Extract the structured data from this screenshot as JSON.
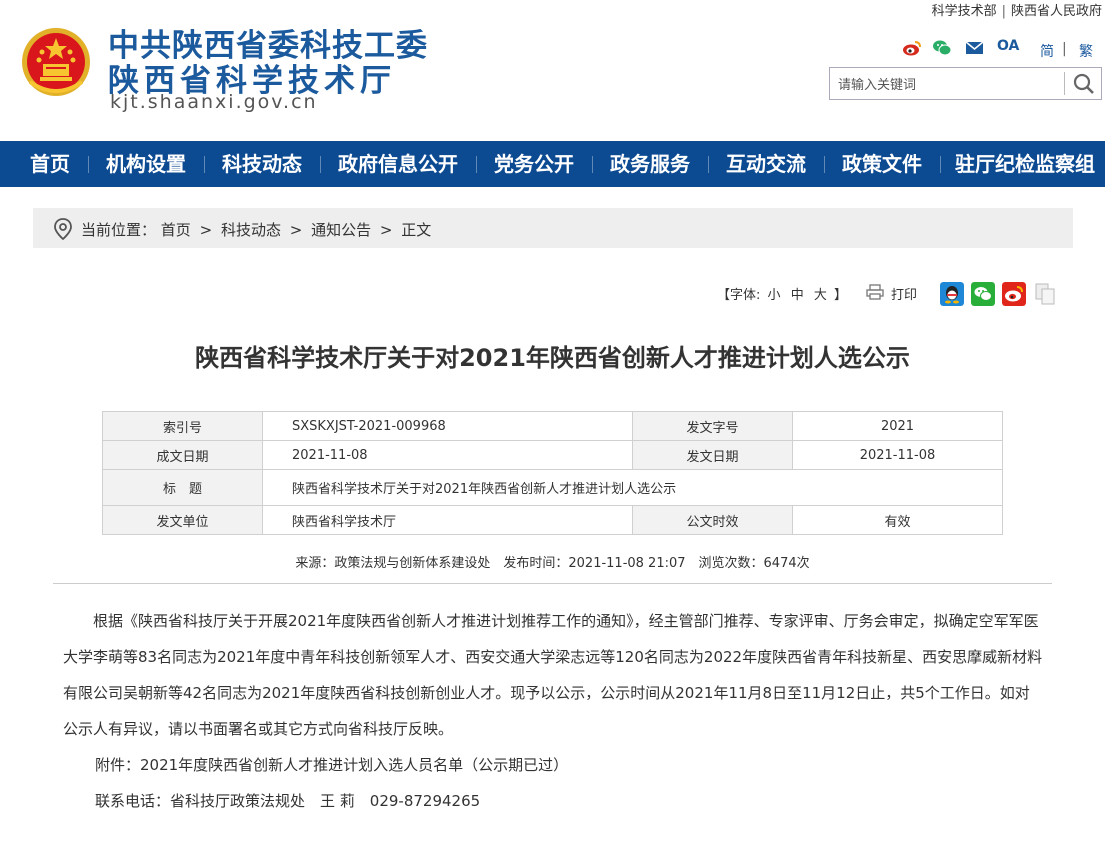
{
  "header": {
    "title_line1": "中共陕西省委科技工委",
    "title_line2": "陕西省科学技术厅",
    "domain": "kjt.shaanxi.gov.cn",
    "top_links": [
      "科学技术部",
      "陕西省人民政府"
    ],
    "top_link_separator": "|",
    "share_icons": [
      "weibo-icon",
      "wechat-icon",
      "mail-icon",
      "oa-icon"
    ],
    "oa_label": "OA",
    "lang_simplified": "简",
    "lang_separator": "|",
    "lang_traditional": "繁",
    "search_placeholder": "请输入关键词"
  },
  "nav": {
    "items": [
      "首页",
      "机构设置",
      "科技动态",
      "政府信息公开",
      "党务公开",
      "政务服务",
      "互动交流",
      "政策文件",
      "驻厅纪检监察组"
    ]
  },
  "breadcrumb": {
    "label": "当前位置：",
    "items": [
      "首页",
      "科技动态",
      "通知公告",
      "正文"
    ],
    "separator": ">"
  },
  "tools": {
    "font_prefix": "【字体:",
    "sizes": [
      "小",
      "中",
      "大"
    ],
    "font_suffix": "】",
    "print_label": "打印",
    "share": [
      "qq-icon",
      "wechat-icon",
      "weibo-icon",
      "copy-icon"
    ]
  },
  "article": {
    "title": "陕西省科学技术厅关于对2021年陕西省创新人才推进计划人选公示",
    "meta": {
      "index_no_label": "索引号",
      "index_no": "SXSKXJST-2021-009968",
      "doc_no_label": "发文字号",
      "doc_no": "2021",
      "created_label": "成文日期",
      "created": "2021-11-08",
      "issued_label": "发文日期",
      "issued": "2021-11-08",
      "subject_label": "标　题",
      "subject": "陕西省科学技术厅关于对2021年陕西省创新人才推进计划人选公示",
      "issuer_label": "发文单位",
      "issuer": "陕西省科学技术厅",
      "validity_label": "公文时效",
      "validity": "有效"
    },
    "source_line": "来源：政策法规与创新体系建设处　发布时间：2021-11-08 21:07　浏览次数：6474次",
    "paragraphs": [
      "根据《陕西省科技厅关于开展2021年度陕西省创新人才推进计划推荐工作的通知》，经主管部门推荐、专家评审、厅务会审定，拟确定空军军医大学李萌等83名同志为2021年度中青年科技创新领军人才、西安交通大学梁志远等120名同志为2022年度陕西省青年科技新星、西安思摩威新材料有限公司吴朝新等42名同志为2021年度陕西省科技创新创业人才。现予以公示，公示时间从2021年11月8日至11月12日止，共5个工作日。如对公示人有异议，请以书面署名或其它方式向省科技厅反映。",
      "附件：2021年度陕西省创新人才推进计划入选人员名单（公示期已过）",
      "联系电话：省科技厅政策法规处　王 莉　029-87294265"
    ]
  },
  "colors": {
    "brand_blue": "#1c5a9e",
    "nav_bg": "#0c4a92",
    "emblem_red": "#d8161b",
    "emblem_gold": "#f7c530"
  }
}
